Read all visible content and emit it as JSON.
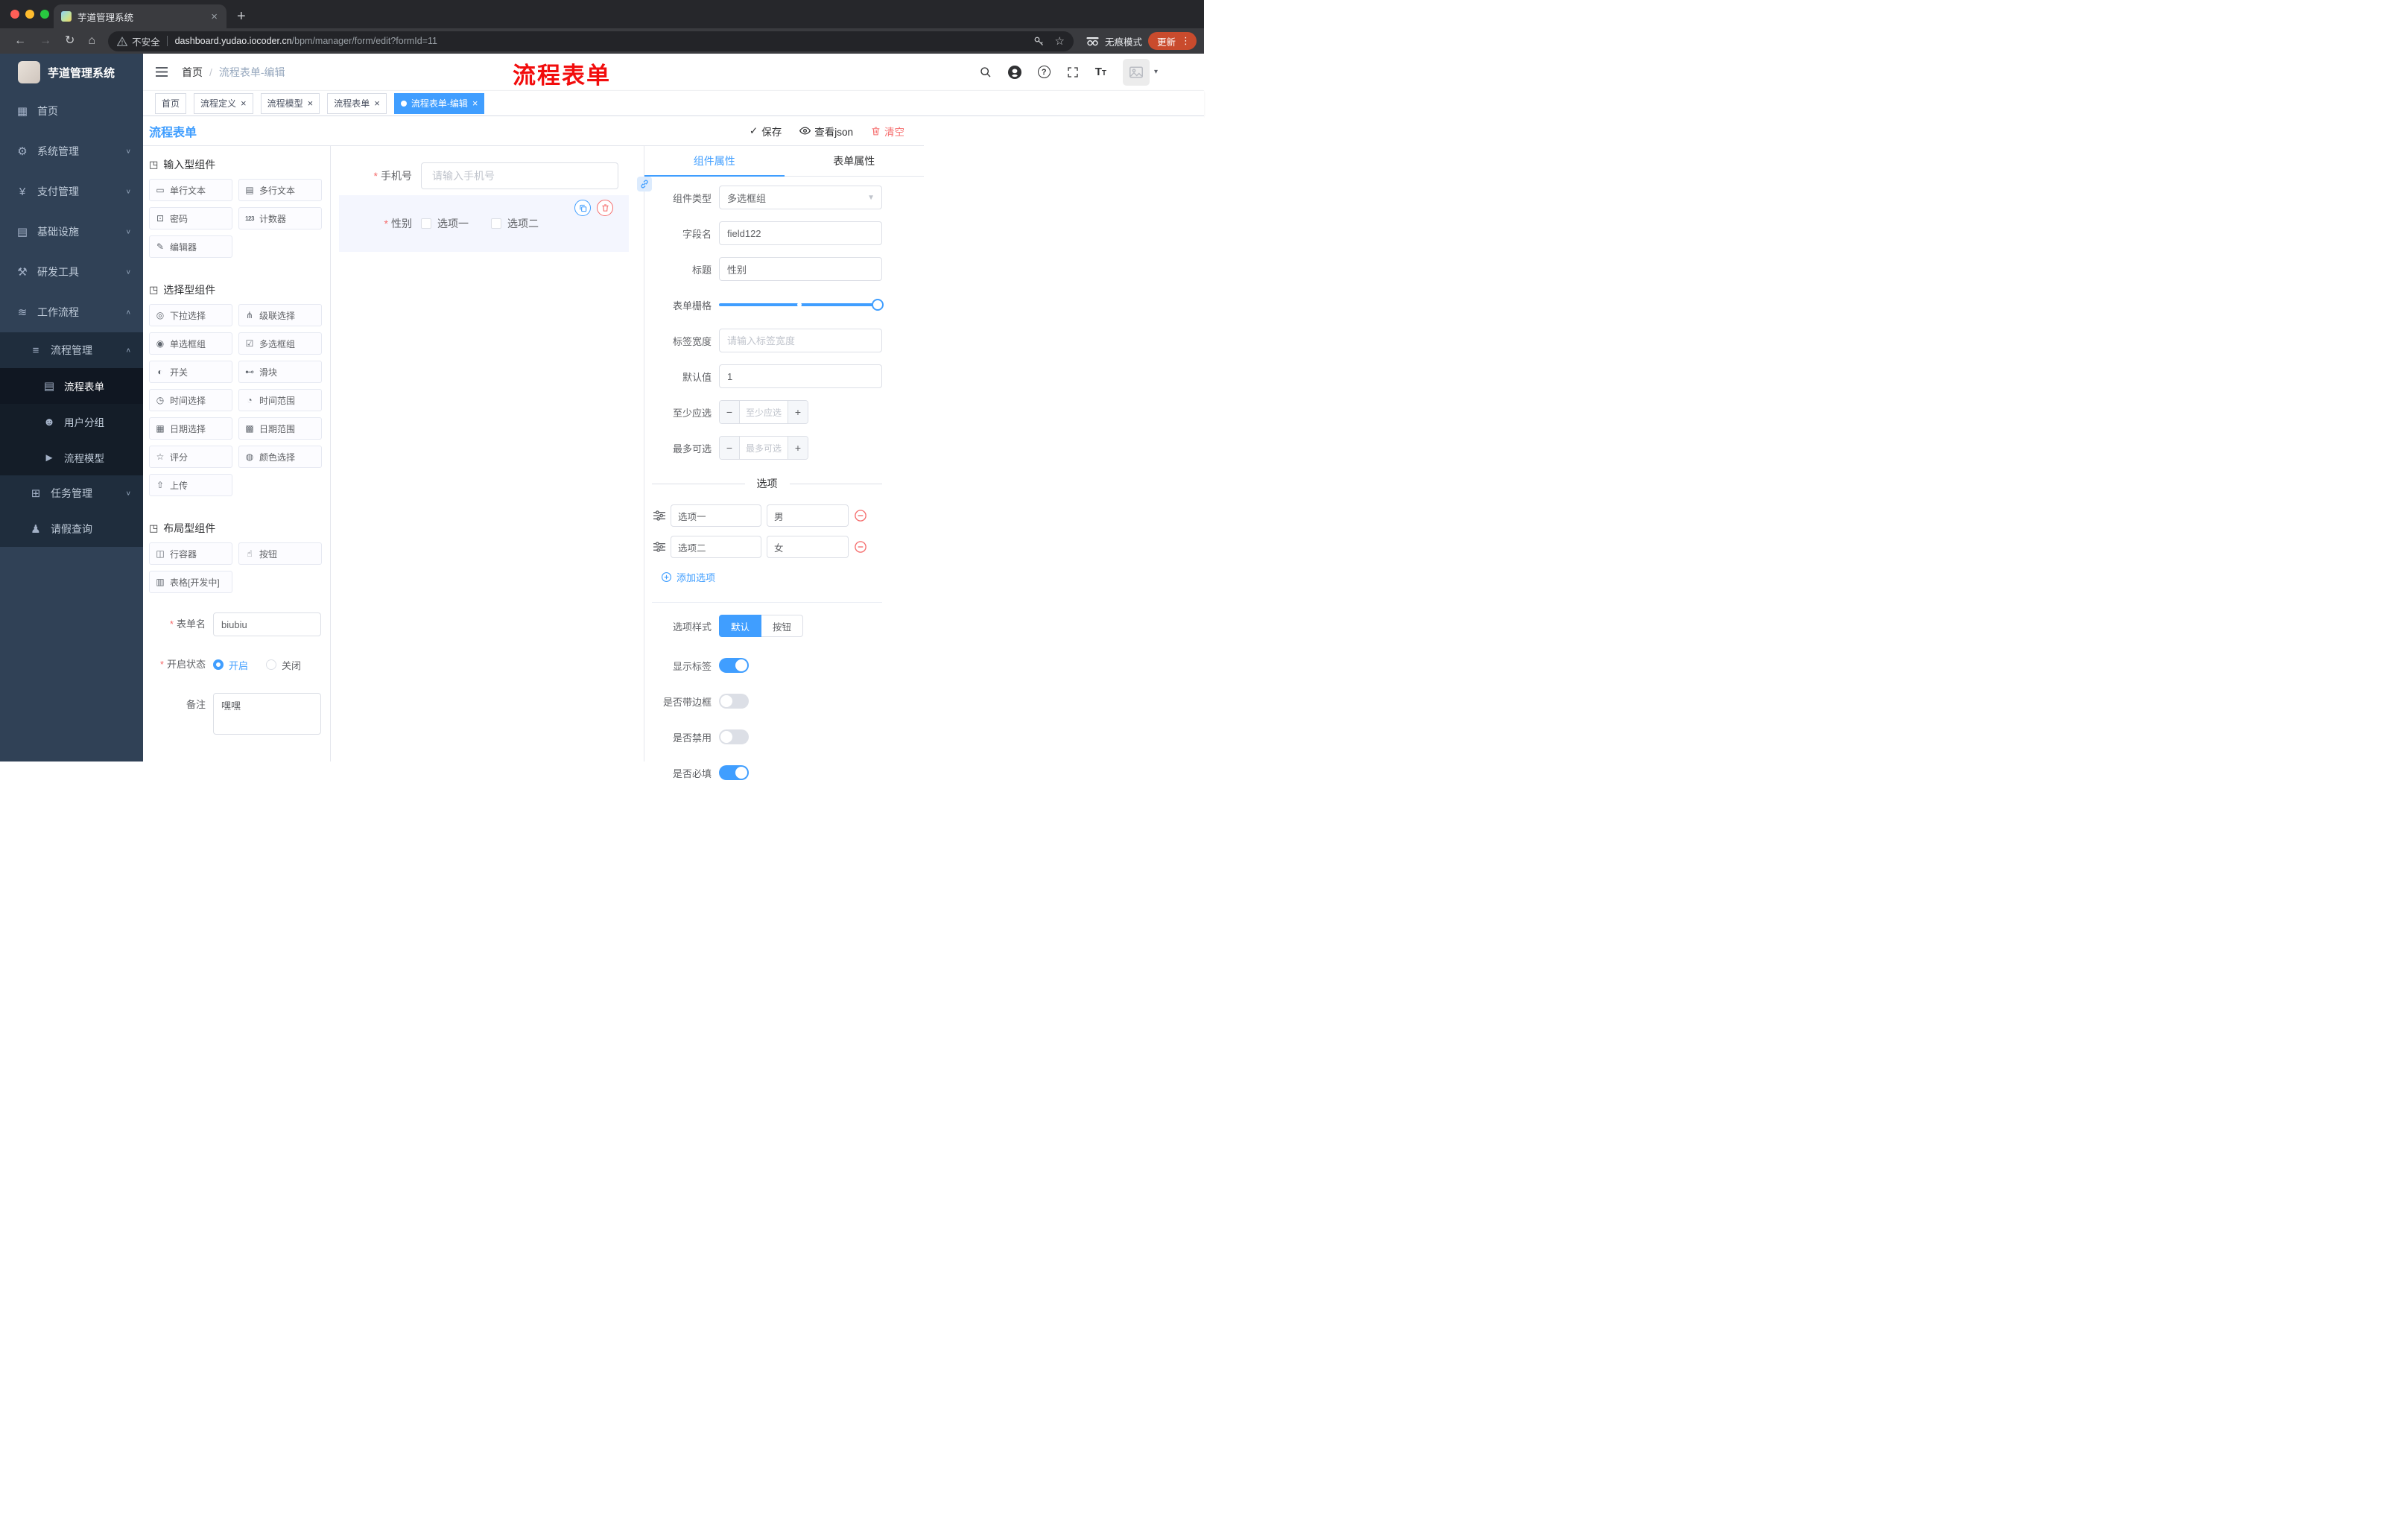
{
  "browser": {
    "tab_title": "芋道管理系统",
    "security_label": "不安全",
    "url_host": "dashboard.yudao.iocoder.cn",
    "url_path": "/bpm/manager/form/edit?formId=11",
    "incognito_label": "无痕模式",
    "update_label": "更新"
  },
  "sidebar": {
    "logo_title": "芋道管理系统",
    "items": [
      {
        "label": "首页"
      },
      {
        "label": "系统管理"
      },
      {
        "label": "支付管理"
      },
      {
        "label": "基础设施"
      },
      {
        "label": "研发工具"
      },
      {
        "label": "工作流程"
      },
      {
        "label": "流程管理"
      },
      {
        "label": "流程表单"
      },
      {
        "label": "用户分组"
      },
      {
        "label": "流程模型"
      },
      {
        "label": "任务管理"
      },
      {
        "label": "请假查询"
      }
    ]
  },
  "header": {
    "breadcrumb_home": "首页",
    "breadcrumb_separator": "/",
    "breadcrumb_current": "流程表单-编辑",
    "annotation": "流程表单"
  },
  "tags": [
    {
      "label": "首页"
    },
    {
      "label": "流程定义"
    },
    {
      "label": "流程模型"
    },
    {
      "label": "流程表单"
    },
    {
      "label": "流程表单-编辑"
    }
  ],
  "designer": {
    "title": "流程表单",
    "toolbar": {
      "save": "保存",
      "view_json": "查看json",
      "clear": "清空"
    },
    "palette": {
      "sections": [
        {
          "title": "输入型组件",
          "items": [
            "单行文本",
            "多行文本",
            "密码",
            "计数器",
            "编辑器"
          ]
        },
        {
          "title": "选择型组件",
          "items": [
            "下拉选择",
            "级联选择",
            "单选框组",
            "多选框组",
            "开关",
            "滑块",
            "时间选择",
            "时间范围",
            "日期选择",
            "日期范围",
            "评分",
            "颜色选择",
            "上传"
          ]
        },
        {
          "title": "布局型组件",
          "items": [
            "行容器",
            "按钮",
            "表格[开发中]"
          ]
        }
      ],
      "form": {
        "name": {
          "label": "表单名",
          "value": "biubiu"
        },
        "status": {
          "label": "开启状态",
          "on": "开启",
          "off": "关闭"
        },
        "remark": {
          "label": "备注",
          "value": "嘿嘿"
        }
      }
    },
    "canvas": {
      "phone_label": "手机号",
      "phone_placeholder": "请输入手机号",
      "gender_label": "性别",
      "gender_options": [
        "选项一",
        "选项二"
      ]
    },
    "props": {
      "tabs": {
        "component": "组件属性",
        "form": "表单属性"
      },
      "component_type": {
        "label": "组件类型",
        "value": "多选框组"
      },
      "field_name": {
        "label": "字段名",
        "value": "field122"
      },
      "title": {
        "label": "标题",
        "value": "性别"
      },
      "grid": {
        "label": "表单栅格"
      },
      "label_width": {
        "label": "标签宽度",
        "placeholder": "请输入标签宽度"
      },
      "default_value": {
        "label": "默认值",
        "value": "1"
      },
      "min_select": {
        "label": "至少应选",
        "placeholder": "至少应选"
      },
      "max_select": {
        "label": "最多可选",
        "placeholder": "最多可选"
      },
      "options_title": "选项",
      "options": [
        {
          "label": "选项一",
          "value": "男"
        },
        {
          "label": "选项二",
          "value": "女"
        }
      ],
      "add_option": "添加选项",
      "option_style": {
        "label": "选项样式",
        "default": "默认",
        "button": "按钮"
      },
      "toggles": [
        {
          "label": "显示标签",
          "state": "on"
        },
        {
          "label": "是否带边框",
          "state": "off"
        },
        {
          "label": "是否禁用",
          "state": "off"
        },
        {
          "label": "是否必填",
          "state": "on"
        }
      ]
    }
  },
  "colors": {
    "primary": "#409eff",
    "danger": "#f56c6c",
    "sidebar_bg": "#304156",
    "annotation_red": "#f20d0d"
  }
}
